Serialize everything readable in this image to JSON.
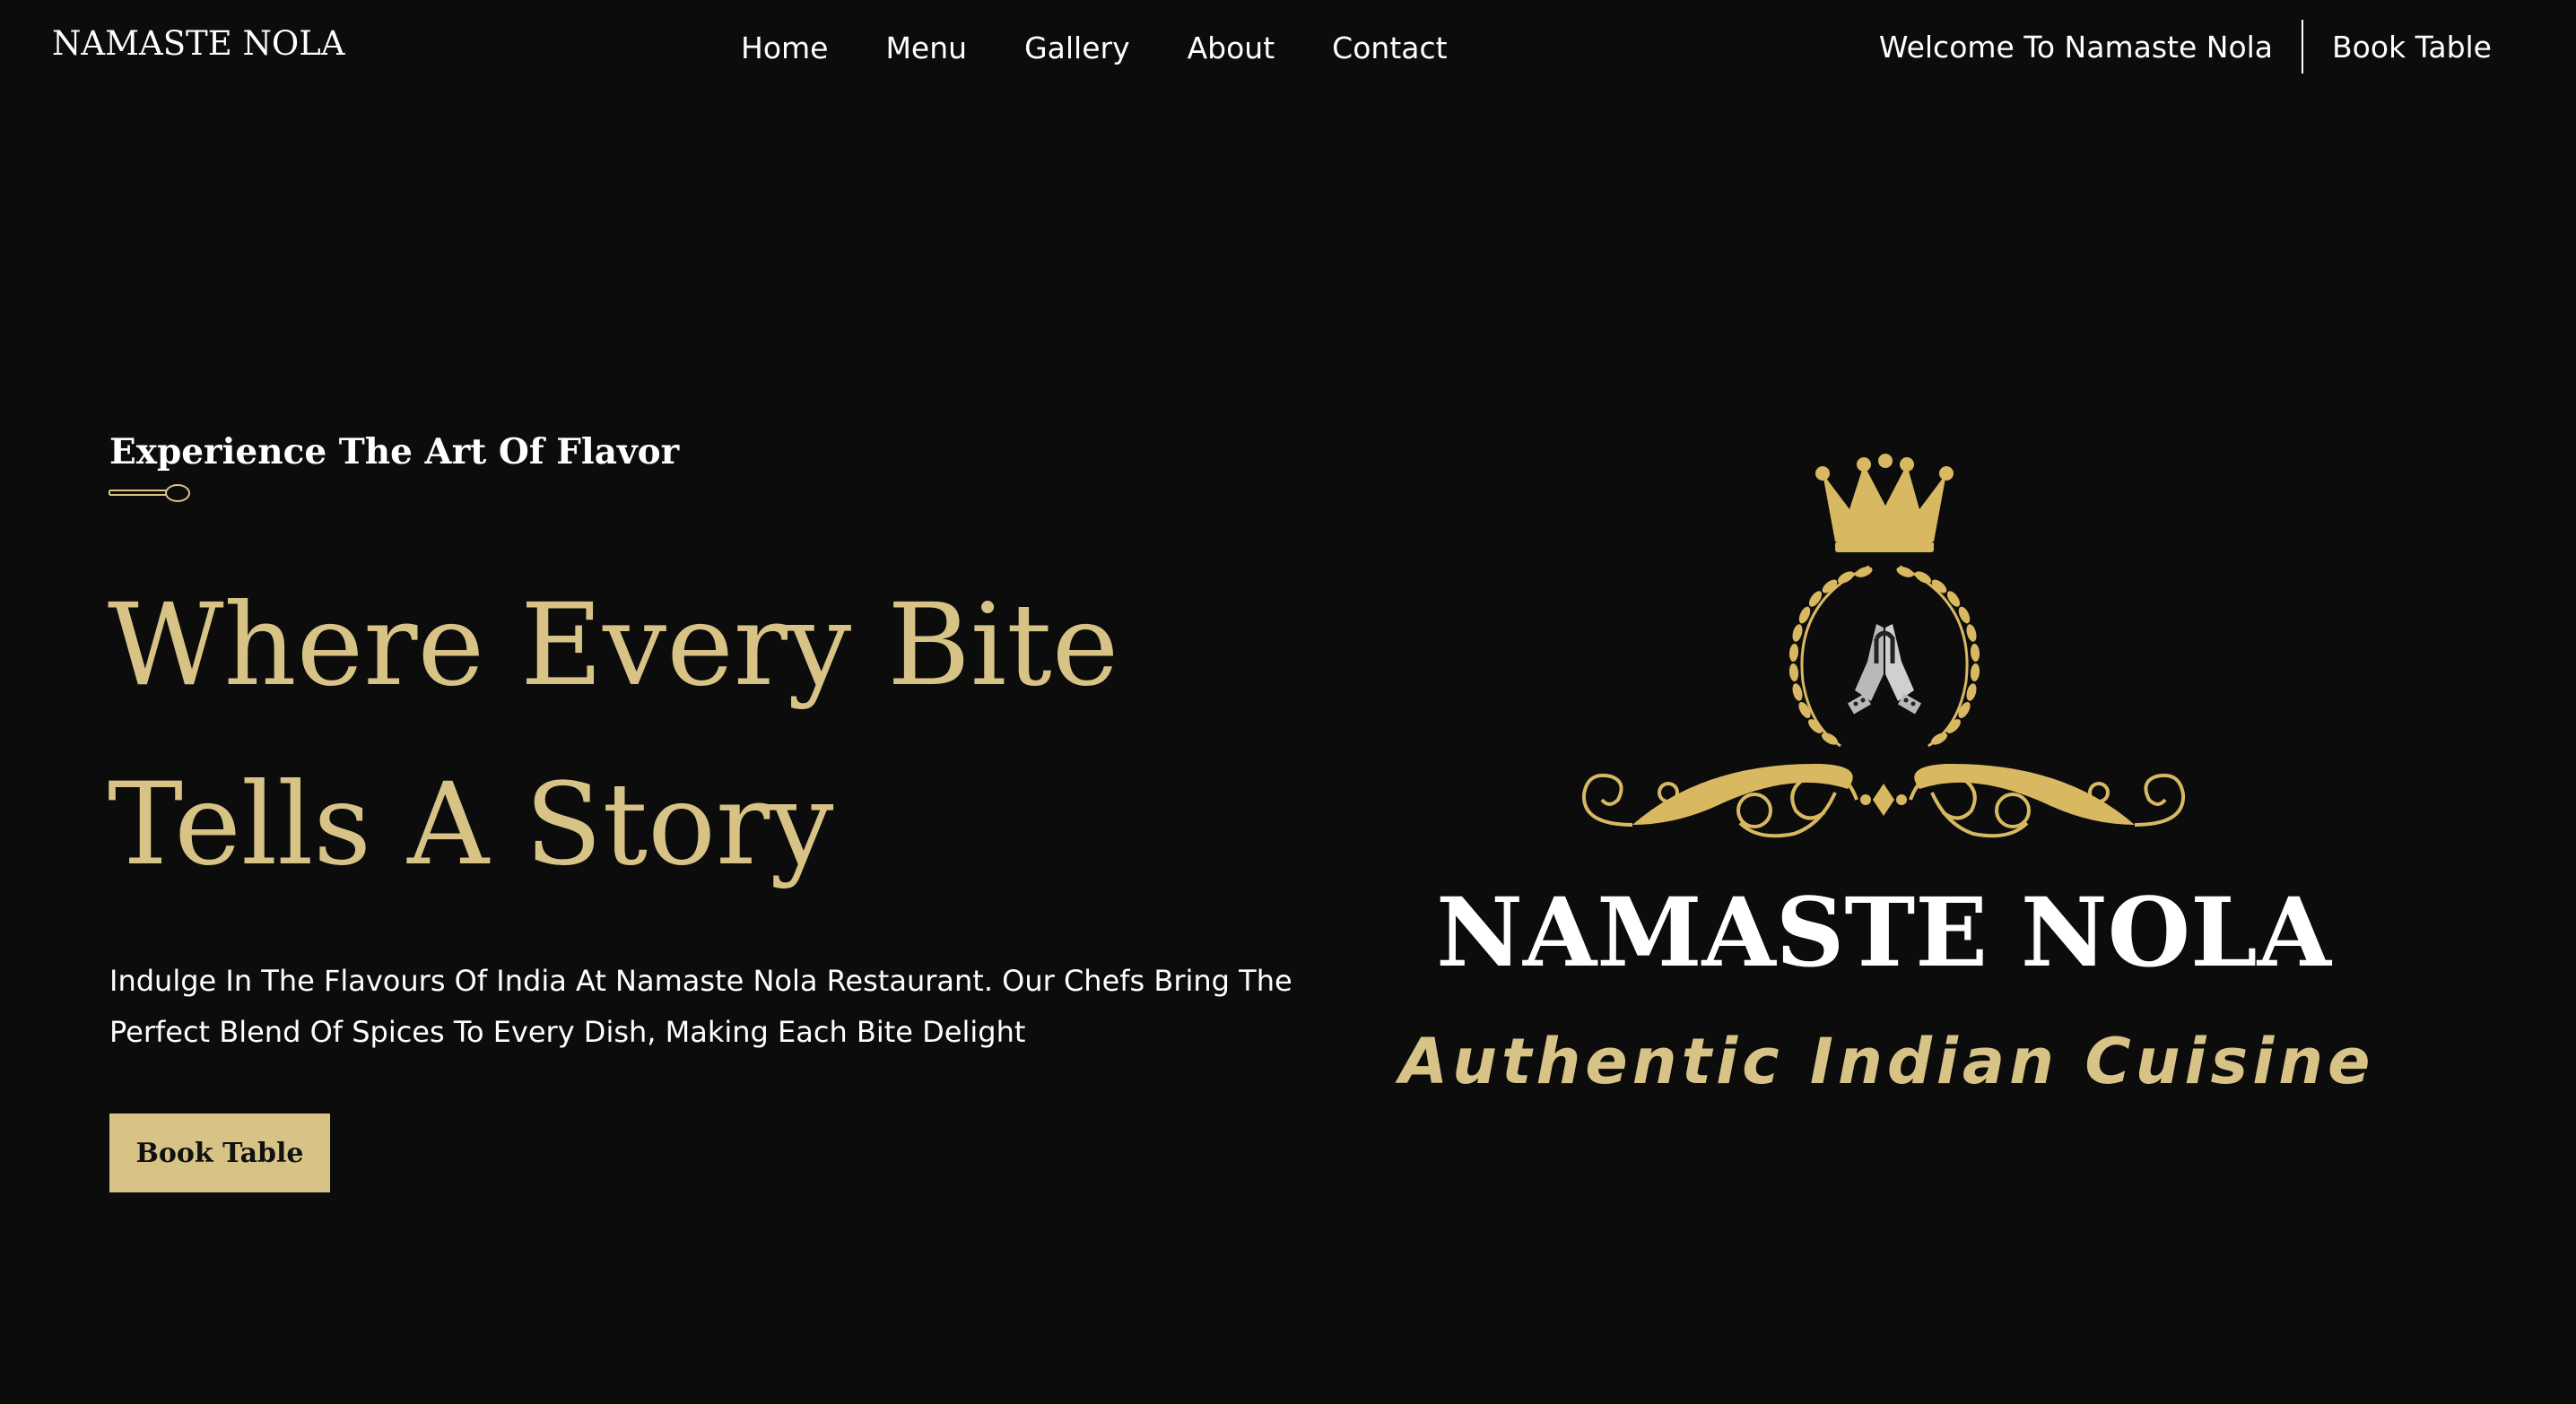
{
  "header": {
    "brand": "NAMASTE NOLA",
    "nav": [
      {
        "label": "Home"
      },
      {
        "label": "Menu"
      },
      {
        "label": "Gallery"
      },
      {
        "label": "About"
      },
      {
        "label": "Contact"
      }
    ],
    "welcome_text": "Welcome To Namaste Nola",
    "book_label": "Book Table"
  },
  "hero": {
    "eyebrow": "Experience The Art Of Flavor",
    "title_line1": "Where Every Bite",
    "title_line2": "Tells A Story",
    "description": "Indulge In The Flavours Of India At Namaste Nola Restaurant. Our Chefs Bring The Perfect Blend Of Spices To Every Dish, Making Each Bite Delight",
    "book_button": "Book Table"
  },
  "logo": {
    "name": "NAMASTE NOLA",
    "tagline": "Authentic Indian Cuisine",
    "emblem_icon": "crown-wreath-namaste-hands-icon"
  },
  "colors": {
    "background": "#0c0c0c",
    "gold": "#d8c387",
    "emblem_gold": "#d9b862",
    "text": "#ffffff"
  }
}
